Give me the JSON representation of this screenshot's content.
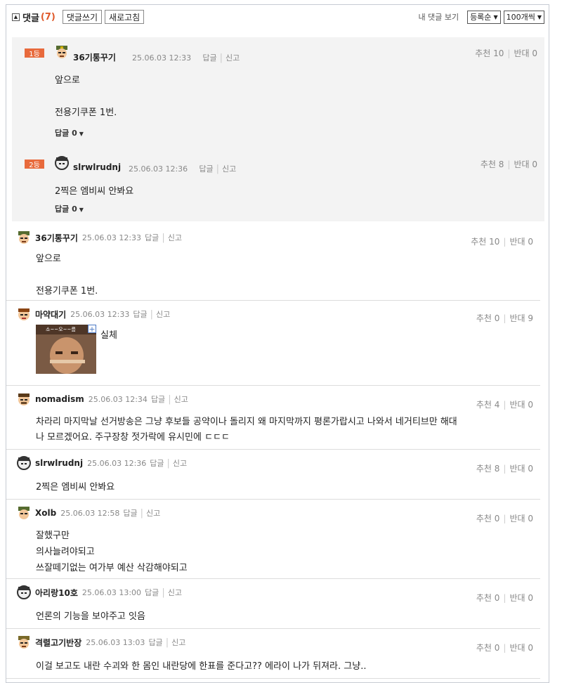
{
  "header": {
    "title": "댓글",
    "count": "(7)",
    "write_btn": "댓글쓰기",
    "refresh_btn": "새로고침",
    "my_comments": "내 댓글 보기",
    "sort_select": "등록순",
    "per_page_select": "100개씩"
  },
  "best": [
    {
      "rank": "1등",
      "nick": "36기통꾸기",
      "time": "25.06.03 12:33",
      "reply": "답글",
      "report": "신고",
      "up": "추천 10",
      "down": "반대 0",
      "lines": [
        "앞으로",
        "",
        "전용기쿠폰 1번."
      ],
      "subreply": "답글 0"
    },
    {
      "rank": "2등",
      "nick": "slrwlrudnj",
      "time": "25.06.03 12:36",
      "reply": "답글",
      "report": "신고",
      "up": "추천 8",
      "down": "반대 0",
      "lines": [
        "2찍은 엠비씨 안봐요"
      ],
      "subreply": "답글 0"
    }
  ],
  "comments": [
    {
      "nick": "36기통꾸기",
      "time": "25.06.03 12:33",
      "reply": "답글",
      "report": "신고",
      "up": "추천 10",
      "down": "반대 0",
      "lines": [
        "앞으로",
        "",
        "전용기쿠폰 1번."
      ]
    },
    {
      "nick": "마약대기",
      "time": "25.06.03 12:33",
      "reply": "답글",
      "report": "신고",
      "up": "추천 0",
      "down": "반대 9",
      "lines": [
        "실체"
      ],
      "image_caption": "소~~오~~름"
    },
    {
      "nick": "nomadism",
      "time": "25.06.03 12:34",
      "reply": "답글",
      "report": "신고",
      "up": "추천 4",
      "down": "반대 0",
      "lines": [
        "차라리 마지막날 선거방송은 그냥 후보들 공약이나 돌리지 왜 마지막까지 평론가랍시고 나와서 네거티브만 해대",
        "나 모르겠어요. 주구장창 젓가락에 유시민에 ㄷㄷㄷ"
      ]
    },
    {
      "nick": "slrwlrudnj",
      "time": "25.06.03 12:36",
      "reply": "답글",
      "report": "신고",
      "up": "추천 8",
      "down": "반대 0",
      "lines": [
        "2찍은 엠비씨 안봐요"
      ]
    },
    {
      "nick": "Xolb",
      "time": "25.06.03 12:58",
      "reply": "답글",
      "report": "신고",
      "up": "추천 0",
      "down": "반대 0",
      "lines": [
        "잘했구만",
        "의사늘려야되고",
        "쓰잘떼기없는 여가부 예산 삭감해야되고"
      ]
    },
    {
      "nick": "아리랑10호",
      "time": "25.06.03 13:00",
      "reply": "답글",
      "report": "신고",
      "up": "추천 0",
      "down": "반대 0",
      "lines": [
        "언론의 기능을 보야주고 잇음"
      ]
    },
    {
      "nick": "격렬고기반장",
      "time": "25.06.03 13:03",
      "reply": "답글",
      "report": "신고",
      "up": "추천 0",
      "down": "반대 0",
      "lines": [
        "이걸 보고도 내란 수괴와 한 몸인 내란당에 한표를 준다고?? 에라이 나가 뒤져라. 그냥.."
      ]
    }
  ]
}
